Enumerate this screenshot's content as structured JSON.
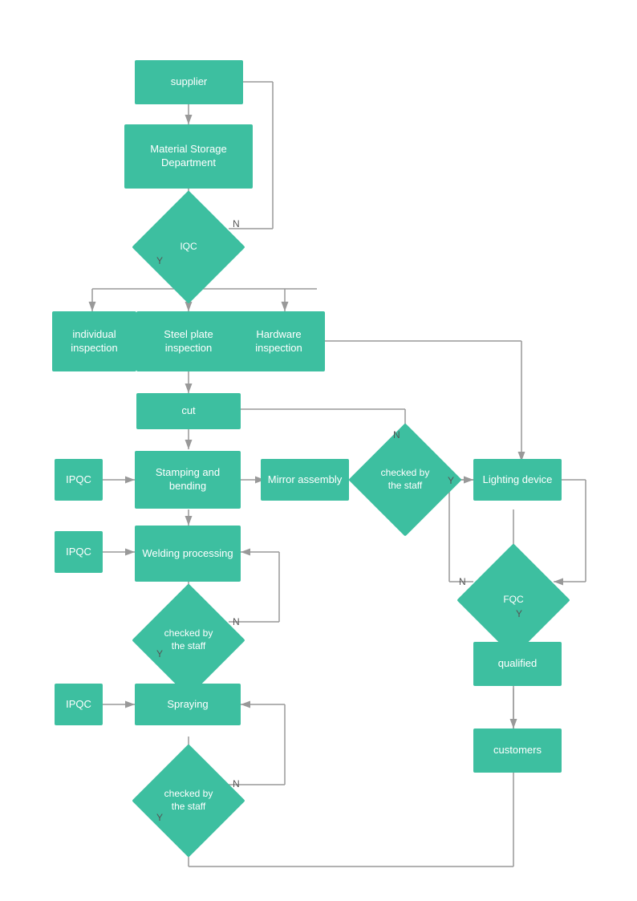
{
  "nodes": {
    "supplier": {
      "label": "supplier"
    },
    "material_storage": {
      "label": "Material Storage Department"
    },
    "iqc": {
      "label": "IQC"
    },
    "individual_inspection": {
      "label": "individual inspection"
    },
    "steel_plate": {
      "label": "Steel plate inspection"
    },
    "hardware_inspection": {
      "label": "Hardware inspection"
    },
    "cut": {
      "label": "cut"
    },
    "ipqc1": {
      "label": "IPQC"
    },
    "stamping": {
      "label": "Stamping and bending"
    },
    "ipqc2": {
      "label": "IPQC"
    },
    "welding": {
      "label": "Welding processing"
    },
    "checked1": {
      "label": "checked by the staff"
    },
    "ipqc3": {
      "label": "IPQC"
    },
    "spraying": {
      "label": "Spraying"
    },
    "checked3": {
      "label": "checked by the staff"
    },
    "mirror_assembly": {
      "label": "Mirror assembly"
    },
    "checked2": {
      "label": "checked by the staff"
    },
    "lighting": {
      "label": "Lighting device"
    },
    "fqc": {
      "label": "FQC"
    },
    "qualified": {
      "label": "qualified"
    },
    "customers": {
      "label": "customers"
    }
  },
  "labels": {
    "n1": "N",
    "y1": "Y",
    "n2": "N",
    "y2": "Y",
    "n3": "N",
    "y3": "Y",
    "n4": "N",
    "y4": "Y",
    "n5": "N",
    "y5": "Y"
  },
  "accent_color": "#3dbfa0"
}
